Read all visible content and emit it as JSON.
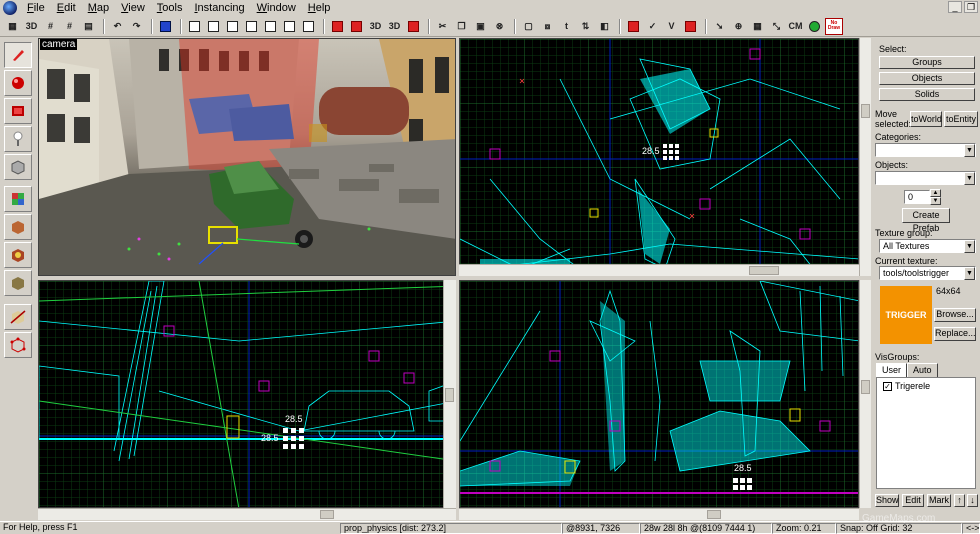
{
  "menu": [
    "File",
    "Edit",
    "Map",
    "View",
    "Tools",
    "Instancing",
    "Window",
    "Help"
  ],
  "toolbar": {
    "icons": [
      "3d-toggle-icon",
      "3d-icon",
      "grid-smaller-icon",
      "grid-larger-icon",
      "grid-icon",
      "undo-icon",
      "redo-icon",
      "carve-icon",
      "vgroup1",
      "vgroup2",
      "vgroup3",
      "vgroup4",
      "vgroup5",
      "vgroup6",
      "vgroup7",
      "vgroup8",
      "vgroup9",
      "vgroup10",
      "vgroup11",
      "vgroup12",
      "cut-icon",
      "copy-icon",
      "paste-icon",
      "ignore-groups-icon",
      "hide-icon",
      "show-icon",
      "snap-icon",
      "texture-lock-icon",
      "cordon-icon",
      "run-map-icon",
      "entity-report-icon",
      "check-problems-icon",
      "cm-icon",
      "sprite-icon",
      "no-draw-icon"
    ],
    "cm_label": "CM",
    "nodraw_label": "No Draw"
  },
  "left_tools": [
    "selection-tool-icon",
    "magnify-tool-icon",
    "camera-tool-icon",
    "entity-tool-icon",
    "block-tool-icon",
    "texture-application-icon",
    "apply-texture-icon",
    "decal-tool-icon",
    "overlay-tool-icon",
    "clipping-tool-icon",
    "vertex-tool-icon"
  ],
  "viewports": {
    "camera_label": "camera",
    "top_tl_number": "28.5",
    "side_number": "28.5",
    "side_number_b": "28.5",
    "front_number": "28.5"
  },
  "right_panel": {
    "select_label": "Select:",
    "groups_btn": "Groups",
    "objects_btn": "Objects",
    "solids_btn": "Solids",
    "move_selected_label": "Move selected:",
    "to_world_btn": "toWorld",
    "to_entity_btn": "toEntity",
    "categories_label": "Categories:",
    "categories_value": "",
    "objects_label": "Objects:",
    "objects_value": "",
    "count_value": "0",
    "create_prefab_btn": "Create Prefab",
    "texture_group_label": "Texture group:",
    "texture_group_value": "All Textures",
    "current_texture_label": "Current texture:",
    "current_texture_value": "tools/toolstrigger",
    "texture_preview_text": "TRIGGER",
    "texture_size": "64x64",
    "browse_btn": "Browse...",
    "replace_btn": "Replace...",
    "visgroups_label": "VisGroups:",
    "tab_user": "User",
    "tab_auto": "Auto",
    "visgroup_item": "Trigerele",
    "show_btn": "Show",
    "edit_btn": "Edit",
    "mark_btn": "Mark",
    "up_btn": "↑",
    "down_btn": "↓"
  },
  "status": {
    "help": "For Help, press F1",
    "object": "prop_physics  [dist: 273.2]",
    "coords": "@8931, 7326",
    "size": "28w 28l 8h @(8109 7444 1)",
    "zoom": "Zoom: 0.21",
    "snap": "Snap: Off Grid: 32",
    "watermark": "GameMaps.com",
    "end": "<->"
  },
  "colors": {
    "wire_cyan": "#00ffff",
    "grid_green": "#1d6a2a",
    "grid_blue": "#0020c0",
    "texture_orange": "#f39200"
  }
}
